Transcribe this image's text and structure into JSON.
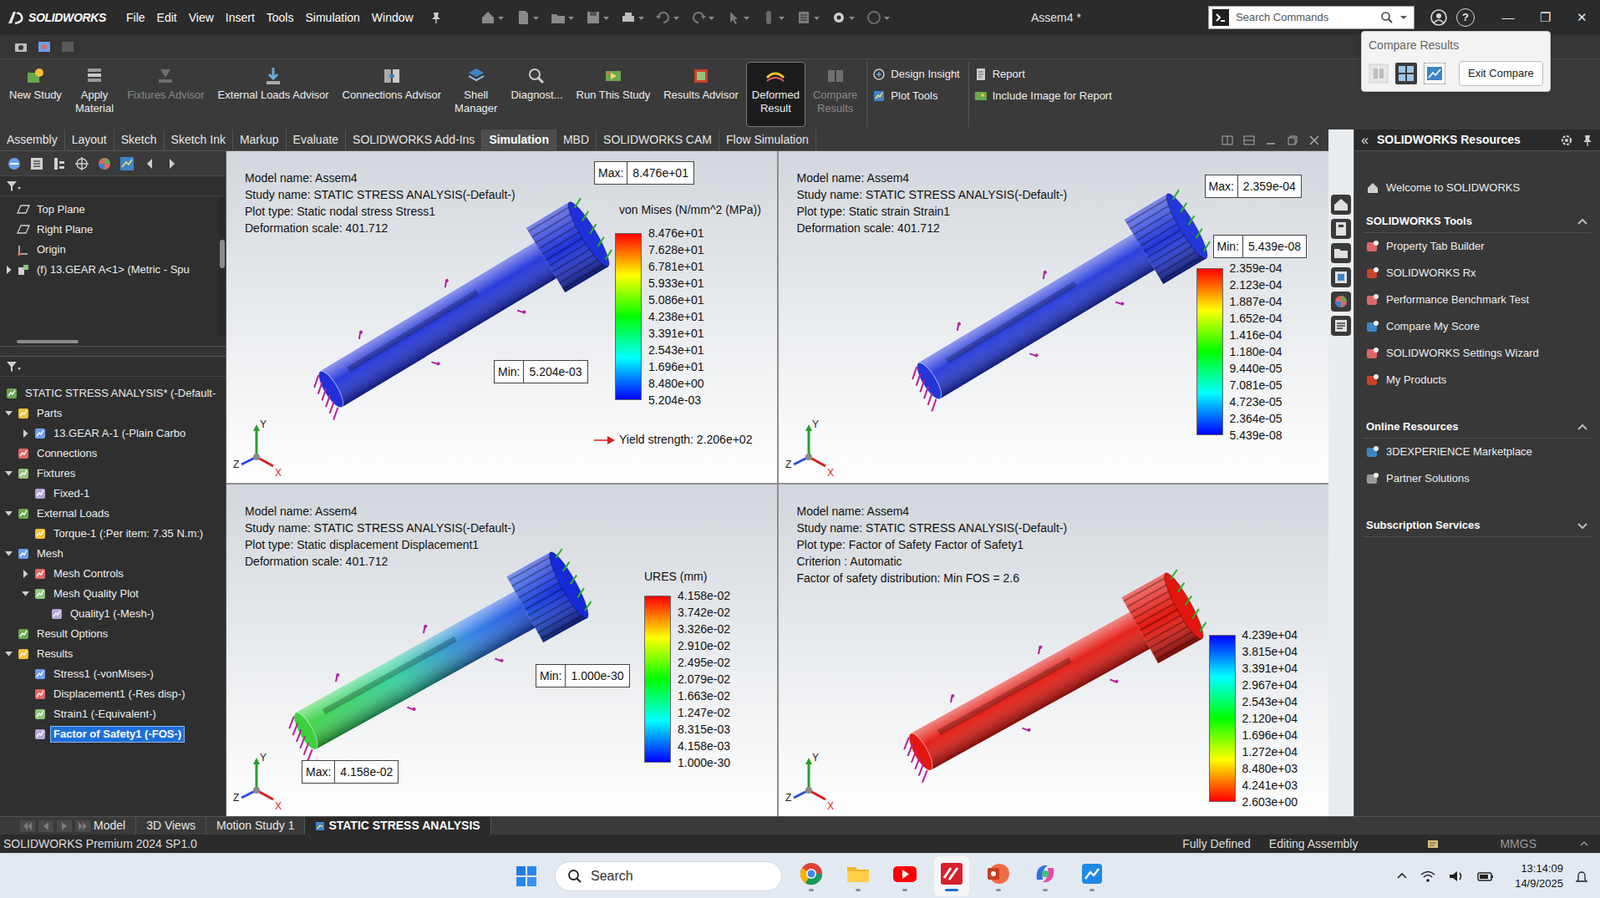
{
  "titlebar": {
    "logo": "SOLIDWORKS",
    "menu": [
      "File",
      "Edit",
      "View",
      "Insert",
      "Tools",
      "Simulation",
      "Window"
    ],
    "title": "Assem4 *",
    "search": {
      "placeholder": "Search Commands"
    },
    "help": "?",
    "controls": [
      "—",
      "❐",
      "✕"
    ]
  },
  "compare_popup": {
    "title": "Compare Results",
    "button": "Exit Compare"
  },
  "ribbon": {
    "large": [
      {
        "lines": [
          "New Study"
        ],
        "disabled": false,
        "selected": false
      },
      {
        "lines": [
          "Apply",
          "Material"
        ],
        "disabled": false,
        "selected": false
      },
      {
        "lines": [
          "Fixtures Advisor"
        ],
        "disabled": true,
        "selected": false
      },
      {
        "lines": [
          "External Loads Advisor"
        ],
        "disabled": false,
        "selected": false
      },
      {
        "lines": [
          "Connections Advisor"
        ],
        "disabled": false,
        "selected": false
      },
      {
        "lines": [
          "Shell",
          "Manager"
        ],
        "disabled": false,
        "selected": false
      },
      {
        "lines": [
          "Diagnost..."
        ],
        "disabled": false,
        "selected": false
      },
      {
        "lines": [
          "Run This Study"
        ],
        "disabled": false,
        "selected": false
      },
      {
        "lines": [
          "Results Advisor"
        ],
        "disabled": false,
        "selected": false
      },
      {
        "lines": [
          "Deformed",
          "Result"
        ],
        "disabled": false,
        "selected": true
      },
      {
        "lines": [
          "Compare",
          "Results"
        ],
        "disabled": true,
        "selected": false
      }
    ],
    "small": [
      [
        "Design Insight",
        "Plot Tools"
      ],
      [
        "Report",
        "Include Image for Report"
      ]
    ]
  },
  "tabs": [
    {
      "label": "Assembly",
      "selected": false
    },
    {
      "label": "Layout",
      "selected": false
    },
    {
      "label": "Sketch",
      "selected": false
    },
    {
      "label": "Sketch Ink",
      "selected": false
    },
    {
      "label": "Markup",
      "selected": false
    },
    {
      "label": "Evaluate",
      "selected": false
    },
    {
      "label": "SOLIDWORKS Add-Ins",
      "selected": false
    },
    {
      "label": "Simulation",
      "selected": true
    },
    {
      "label": "MBD",
      "selected": false
    },
    {
      "label": "SOLIDWORKS CAM",
      "selected": false
    },
    {
      "label": "Flow Simulation",
      "selected": false
    }
  ],
  "feature_tree": [
    {
      "label": "Top Plane",
      "depth": 1,
      "selected": false
    },
    {
      "label": "Right Plane",
      "depth": 1,
      "selected": false
    },
    {
      "label": "Origin",
      "depth": 1,
      "selected": false
    },
    {
      "label": "(f) 13.GEAR A<1> (Metric - Spu",
      "depth": 1,
      "expanded": false,
      "selected": false
    }
  ],
  "study_tree": [
    {
      "label": "STATIC STRESS ANALYSIS* (-Default-",
      "depth": 0,
      "selected": false
    },
    {
      "label": "Parts",
      "depth": 1,
      "expanded": true,
      "selected": false
    },
    {
      "label": "13.GEAR A-1 (-Plain Carbo",
      "depth": 2,
      "expanded": false,
      "selected": false
    },
    {
      "label": "Connections",
      "depth": 1,
      "selected": false
    },
    {
      "label": "Fixtures",
      "depth": 1,
      "expanded": true,
      "selected": false
    },
    {
      "label": "Fixed-1",
      "depth": 2,
      "selected": false
    },
    {
      "label": "External Loads",
      "depth": 1,
      "expanded": true,
      "selected": false
    },
    {
      "label": "Torque-1 (:Per item: 7.35 N.m:)",
      "depth": 2,
      "selected": false
    },
    {
      "label": "Mesh",
      "depth": 1,
      "expanded": true,
      "selected": false
    },
    {
      "label": "Mesh Controls",
      "depth": 2,
      "expanded": false,
      "selected": false
    },
    {
      "label": "Mesh Quality Plot",
      "depth": 2,
      "expanded": true,
      "selected": false
    },
    {
      "label": "Quality1 (-Mesh-)",
      "depth": 3,
      "selected": false
    },
    {
      "label": "Result Options",
      "depth": 1,
      "selected": false
    },
    {
      "label": "Results",
      "depth": 1,
      "expanded": true,
      "selected": false
    },
    {
      "label": "Stress1 (-vonMises-)",
      "depth": 2,
      "selected": false
    },
    {
      "label": "Displacement1 (-Res disp-)",
      "depth": 2,
      "selected": false
    },
    {
      "label": "Strain1 (-Equivalent-)",
      "depth": 2,
      "selected": false
    },
    {
      "label": "Factor of Safety1 (-FOS-)",
      "depth": 2,
      "selected": true
    }
  ],
  "triad": {
    "x": "X",
    "y": "Y",
    "z": "Z"
  },
  "viewports": [
    {
      "kind": "stress",
      "color": "#1f30d8",
      "lines": [
        "Model name: Assem4",
        "Study name: STATIC STRESS ANALYSIS(-Default-)",
        "Plot type: Static nodal stress Stress1",
        "Deformation scale: 401.712"
      ],
      "legend_title": "von Mises (N/mm^2 (MPa))",
      "ticks": [
        "8.476e+01",
        "7.628e+01",
        "6.781e+01",
        "5.933e+01",
        "5.086e+01",
        "4.238e+01",
        "3.391e+01",
        "2.543e+01",
        "1.696e+01",
        "8.480e+00",
        "5.204e-03"
      ],
      "max": {
        "label": "Max:",
        "value": "8.476e+01"
      },
      "min": {
        "label": "Min:",
        "value": "5.204e-03"
      },
      "yield": "Yield strength: 2.206e+02"
    },
    {
      "kind": "strain",
      "color": "#2236d9",
      "lines": [
        "Model name: Assem4",
        "Study name: STATIC STRESS ANALYSIS(-Default-)",
        "Plot type: Static strain Strain1",
        "Deformation scale: 401.712"
      ],
      "ticks": [
        "2.359e-04",
        "2.123e-04",
        "1.887e-04",
        "1.652e-04",
        "1.416e-04",
        "1.180e-04",
        "9.440e-05",
        "7.081e-05",
        "4.723e-05",
        "2.364e-05",
        "5.439e-08"
      ],
      "max": {
        "label": "Max:",
        "value": "2.359e-04"
      },
      "min": {
        "label": "Min:",
        "value": "5.439e-08"
      }
    },
    {
      "kind": "displacement",
      "color": "#1428d8",
      "lines": [
        "Model name: Assem4",
        "Study name: STATIC STRESS ANALYSIS(-Default-)",
        "Plot type: Static displacement Displacement1",
        "Deformation scale: 401.712"
      ],
      "legend_title": "URES (mm)",
      "ticks": [
        "4.158e-02",
        "3.742e-02",
        "3.326e-02",
        "2.910e-02",
        "2.495e-02",
        "2.079e-02",
        "1.663e-02",
        "1.247e-02",
        "8.315e-03",
        "4.158e-03",
        "1.000e-30"
      ],
      "max": {
        "label": "Max:",
        "value": "4.158e-02"
      },
      "min": {
        "label": "Min:",
        "value": "1.000e-30"
      }
    },
    {
      "kind": "safety",
      "color": "#e3170f",
      "lines": [
        "Model name: Assem4",
        "Study name: STATIC STRESS ANALYSIS(-Default-)",
        "Plot type: Factor of Safety Factor of Safety1",
        "Criterion : Automatic",
        "Factor of safety distribution: Min FOS = 2.6"
      ],
      "ticks": [
        "4.239e+04",
        "3.815e+04",
        "3.391e+04",
        "2.967e+04",
        "2.543e+04",
        "2.120e+04",
        "1.696e+04",
        "1.272e+04",
        "8.480e+03",
        "4.241e+03",
        "2.603e+00"
      ]
    }
  ],
  "resources": {
    "collapse": "«",
    "title": "SOLIDWORKS Resources",
    "welcome": "Welcome to SOLIDWORKS",
    "sections": [
      {
        "title": "SOLIDWORKS Tools",
        "expanded": true,
        "items": [
          "Property Tab Builder",
          "SOLIDWORKS Rx",
          "Performance Benchmark Test",
          "Compare My Score",
          "SOLIDWORKS Settings Wizard",
          "My Products"
        ]
      },
      {
        "title": "Online Resources",
        "expanded": true,
        "items": [
          "3DEXPERIENCE Marketplace",
          "Partner Solutions"
        ]
      },
      {
        "title": "Subscription Services",
        "expanded": false,
        "items": []
      }
    ]
  },
  "bottom_tabs": [
    {
      "label": "Model",
      "selected": false
    },
    {
      "label": "3D Views",
      "selected": false
    },
    {
      "label": "Motion Study 1",
      "selected": false
    },
    {
      "label": "STATIC STRESS ANALYSIS",
      "selected": true
    }
  ],
  "status_bar": {
    "product": "SOLIDWORKS Premium 2024 SP1.0",
    "items": [
      "Fully Defined",
      "Editing Assembly"
    ],
    "units": "MMGS"
  },
  "taskbar": {
    "search": "Search",
    "apps": [
      {
        "running": true,
        "active": false
      },
      {
        "running": true,
        "active": false
      },
      {
        "running": true,
        "active": false
      },
      {
        "running": true,
        "active": true
      },
      {
        "running": true,
        "active": false
      },
      {
        "running": true,
        "active": false
      },
      {
        "running": true,
        "active": false
      }
    ],
    "time": "13:14:09",
    "date": "14/9/2025"
  }
}
